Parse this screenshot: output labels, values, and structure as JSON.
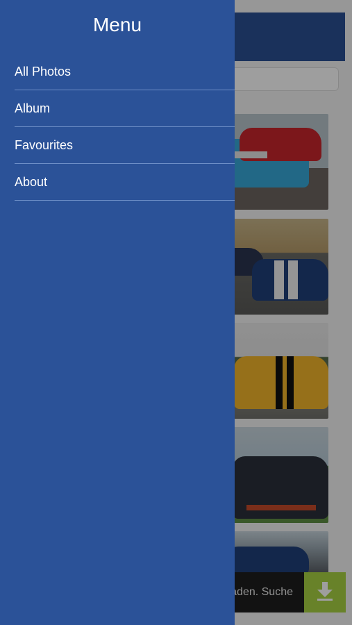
{
  "drawer": {
    "title": "Menu",
    "items": [
      {
        "label": "All Photos"
      },
      {
        "label": "Album"
      },
      {
        "label": "Favourites"
      },
      {
        "label": "About"
      }
    ]
  },
  "background": {
    "footer_text": "aden. Suche",
    "icons": {
      "download": "download-icon"
    }
  },
  "colors": {
    "drawer": "#2b5298",
    "header": "#2b4f93",
    "download_button": "#a9d243"
  }
}
